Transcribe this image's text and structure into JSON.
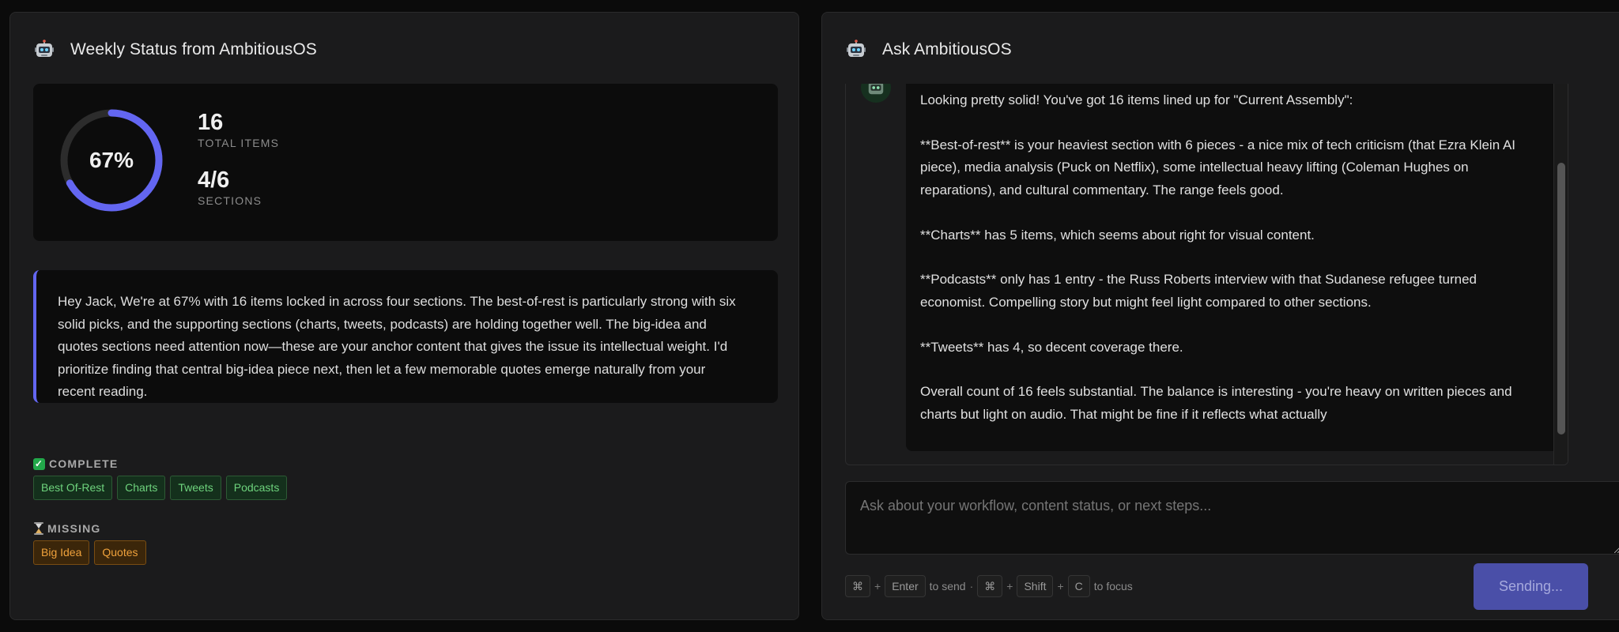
{
  "status_panel": {
    "title": "Weekly Status from AmbitiousOS",
    "icon": "robot-icon",
    "progress": {
      "percent_label": "67%",
      "fraction": 0.67,
      "accent": "#6366f1"
    },
    "stats": [
      {
        "value": "16",
        "label": "TOTAL ITEMS"
      },
      {
        "value": "4/6",
        "label": "SECTIONS"
      }
    ],
    "message": "Hey Jack, We're at 67% with 16 items locked in across four sections. The best-of-rest is particularly strong with six solid picks, and the supporting sections (charts, tweets, podcasts) are holding together well. The big-idea and quotes sections need attention now—these are your anchor content that gives the issue its intellectual weight. I'd prioritize finding that central big-idea piece next, then let a few memorable quotes emerge naturally from your recent reading.",
    "complete": {
      "label": "COMPLETE",
      "icon": "checkmark-icon",
      "tags": [
        "Best Of-Rest",
        "Charts",
        "Tweets",
        "Podcasts"
      ]
    },
    "missing": {
      "label": "MISSING",
      "icon": "hourglass-icon",
      "tags": [
        "Big Idea",
        "Quotes"
      ]
    }
  },
  "chat_panel": {
    "title": "Ask AmbitiousOS",
    "icon": "robot-icon",
    "messages": [
      {
        "role": "assistant",
        "paragraphs": [
          "Looking pretty solid! You've got 16 items lined up for \"Current Assembly\":",
          "**Best-of-rest** is your heaviest section with 6 pieces - a nice mix of tech criticism (that Ezra Klein AI piece), media analysis (Puck on Netflix), some intellectual heavy lifting (Coleman Hughes on reparations), and cultural commentary. The range feels good.",
          "**Charts** has 5 items, which seems about right for visual content.",
          "**Podcasts** only has 1 entry - the Russ Roberts interview with that Sudanese refugee turned economist. Compelling story but might feel light compared to other sections.",
          "**Tweets** has 4, so decent coverage there.",
          "Overall count of 16 feels substantial. The balance is interesting - you're heavy on written pieces and charts but light on audio. That might be fine if it reflects what actually"
        ]
      }
    ],
    "input_placeholder": "Ask about your workflow, content status, or next steps...",
    "shortcuts": {
      "send_keys": [
        "⌘",
        "Enter"
      ],
      "send_text": "to send",
      "dot": "·",
      "focus_keys": [
        "⌘",
        "Shift",
        "C"
      ],
      "focus_text": "to focus",
      "plus": "+"
    },
    "send_button_label": "Sending..."
  }
}
